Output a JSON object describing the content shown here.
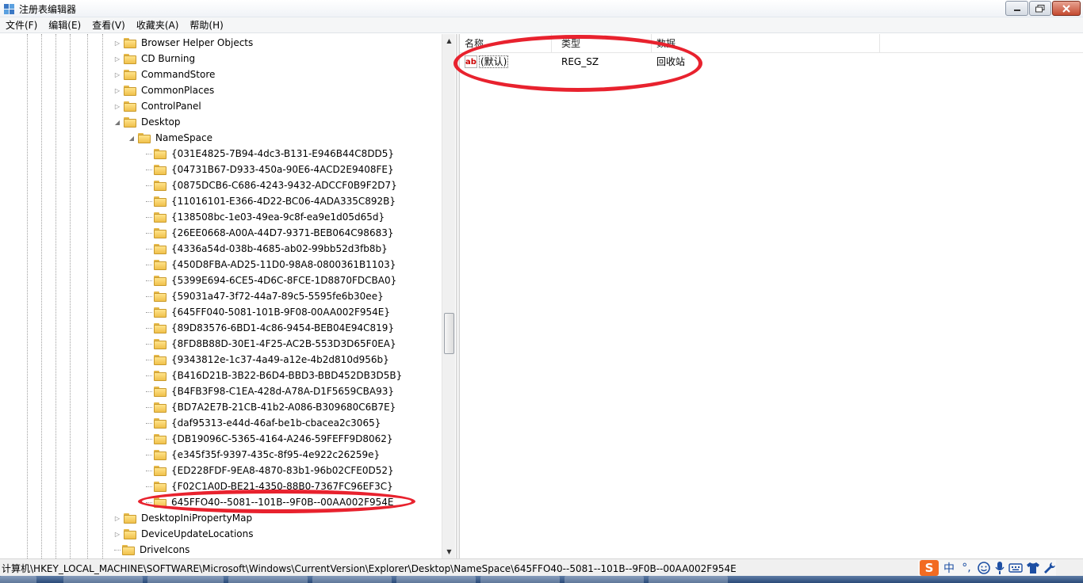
{
  "window": {
    "title": "注册表编辑器"
  },
  "menu": [
    "文件(F)",
    "编辑(E)",
    "查看(V)",
    "收藏夹(A)",
    "帮助(H)"
  ],
  "tree": {
    "top_items": [
      "Browser Helper Objects",
      "CD Burning",
      "CommandStore",
      "CommonPlaces",
      "ControlPanel",
      "Desktop"
    ],
    "namespace_label": "NameSpace",
    "namespace_children": [
      "{031E4825-7B94-4dc3-B131-E946B44C8DD5}",
      "{04731B67-D933-450a-90E6-4ACD2E9408FE}",
      "{0875DCB6-C686-4243-9432-ADCCF0B9F2D7}",
      "{11016101-E366-4D22-BC06-4ADA335C892B}",
      "{138508bc-1e03-49ea-9c8f-ea9e1d05d65d}",
      "{26EE0668-A00A-44D7-9371-BEB064C98683}",
      "{4336a54d-038b-4685-ab02-99bb52d3fb8b}",
      "{450D8FBA-AD25-11D0-98A8-0800361B1103}",
      "{5399E694-6CE5-4D6C-8FCE-1D8870FDCBA0}",
      "{59031a47-3f72-44a7-89c5-5595fe6b30ee}",
      "{645FF040-5081-101B-9F08-00AA002F954E}",
      "{89D83576-6BD1-4c86-9454-BEB04E94C819}",
      "{8FD8B88D-30E1-4F25-AC2B-553D3D65F0EA}",
      "{9343812e-1c37-4a49-a12e-4b2d810d956b}",
      "{B416D21B-3B22-B6D4-BBD3-BBD452DB3D5B}",
      "{B4FB3F98-C1EA-428d-A78A-D1F5659CBA93}",
      "{BD7A2E7B-21CB-41b2-A086-B309680C6B7E}",
      "{daf95313-e44d-46af-be1b-cbacea2c3065}",
      "{DB19096C-5365-4164-A246-59FEFF9D8062}",
      "{e345f35f-9397-435c-8f95-4e922c26259e}",
      "{ED228FDF-9EA8-4870-83b1-96b02CFE0D52}",
      "{F02C1A0D-BE21-4350-88B0-7367FC96EF3C}",
      "645FFO40--5081--101B--9F0B--00AA002F954E"
    ],
    "after_items": [
      "DesktopIniPropertyMap",
      "DeviceUpdateLocations",
      "DriveIcons"
    ]
  },
  "list": {
    "columns": [
      "名称",
      "类型",
      "数据"
    ],
    "rows": [
      {
        "name": "(默认)",
        "type": "REG_SZ",
        "data": "回收站"
      }
    ]
  },
  "status": {
    "path": "计算机\\HKEY_LOCAL_MACHINE\\SOFTWARE\\Microsoft\\Windows\\CurrentVersion\\Explorer\\Desktop\\NameSpace\\645FFO40--5081--101B--9F0B--00AA002F954E"
  },
  "ime": {
    "logo": "S",
    "mode": "中",
    "punct": "°,"
  },
  "colors": {
    "annotation": "#e8222e",
    "folder": "#f0c14b",
    "close_button": "#c44a30"
  }
}
